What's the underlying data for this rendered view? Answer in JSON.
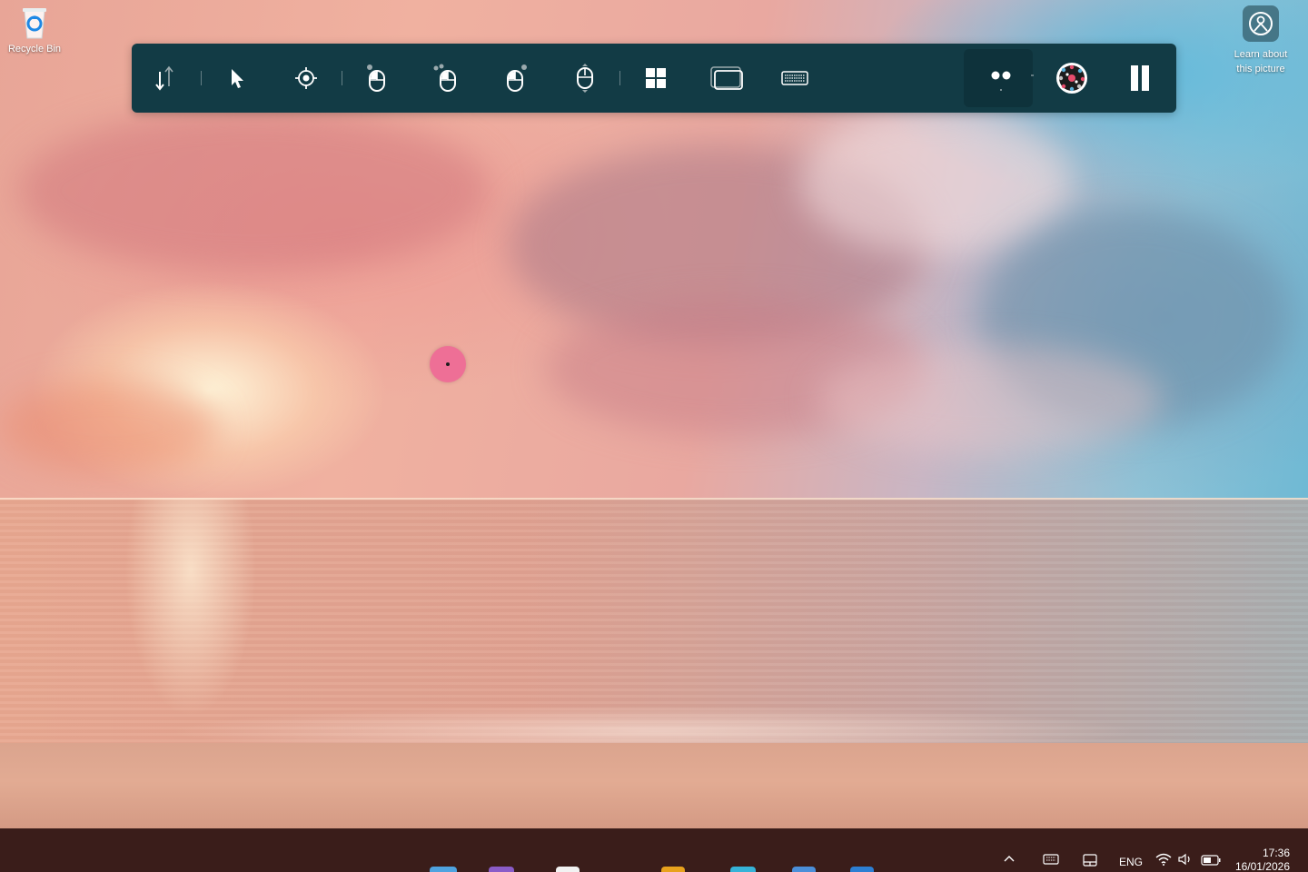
{
  "desktop": {
    "recycle_bin_label": "Recycle Bin",
    "learn_about_line1": "Learn about",
    "learn_about_line2": "this picture"
  },
  "toolbar": {
    "buttons": [
      {
        "name": "scroll-mode-button",
        "icon": "scroll-arrows-icon"
      },
      {
        "name": "left-click-button",
        "icon": "pointer-icon"
      },
      {
        "name": "precise-select-button",
        "icon": "crosshair-icon"
      },
      {
        "name": "left-click-mouse-button",
        "icon": "mouse-left-icon"
      },
      {
        "name": "double-click-mouse-button",
        "icon": "mouse-double-icon"
      },
      {
        "name": "right-click-mouse-button",
        "icon": "mouse-right-icon"
      },
      {
        "name": "scroll-wheel-button",
        "icon": "mouse-scroll-icon"
      },
      {
        "name": "start-menu-button",
        "icon": "windows-logo-icon"
      },
      {
        "name": "task-view-button",
        "icon": "task-view-icon"
      },
      {
        "name": "keyboard-button",
        "icon": "keyboard-icon"
      },
      {
        "name": "eye-tracking-button",
        "icon": "eyes-icon"
      },
      {
        "name": "calibration-button",
        "icon": "calibration-icon"
      },
      {
        "name": "pause-button",
        "icon": "pause-icon"
      }
    ],
    "colors": {
      "background": "#123b45",
      "active": "#0e323b",
      "icon": "#ffffff"
    }
  },
  "gaze_cursor": {
    "color": "#ee6f96"
  },
  "taskbar": {
    "language": "ENG",
    "time": "17:36",
    "date": "16/01/2026",
    "background": "#3a1d1a"
  }
}
